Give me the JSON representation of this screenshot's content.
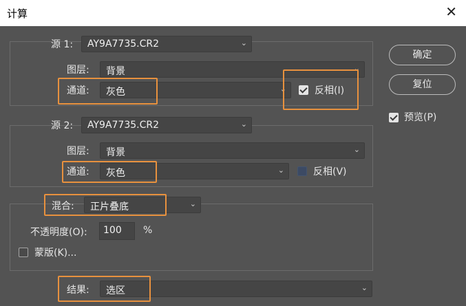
{
  "window": {
    "title": "计算",
    "close_glyph": "✕"
  },
  "source1": {
    "label": "源 1:",
    "file": "AY9A7735.CR2",
    "layer_label": "图层:",
    "layer": "背景",
    "channel_label": "通道:",
    "channel": "灰色",
    "invert_label": "反相(I)",
    "invert_checked": true
  },
  "source2": {
    "label": "源 2:",
    "file": "AY9A7735.CR2",
    "layer_label": "图层:",
    "layer": "背景",
    "channel_label": "通道:",
    "channel": "灰色",
    "invert_label": "反相(V)",
    "invert_checked": false
  },
  "blending": {
    "label": "混合:",
    "mode": "正片叠底",
    "opacity_label": "不透明度(O):",
    "opacity": "100",
    "opacity_unit": "%",
    "mask_label": "蒙版(K)...",
    "mask_checked": false
  },
  "result": {
    "label": "结果:",
    "value": "选区"
  },
  "buttons": {
    "ok": "确定",
    "reset": "复位"
  },
  "preview": {
    "label": "预览(P)",
    "checked": true
  },
  "icons": {
    "dropdown": "chevron-down-icon",
    "close": "close-icon",
    "check": "checkmark-icon"
  },
  "colors": {
    "highlight": "#e8913e",
    "background": "#535353",
    "field": "#454545"
  }
}
